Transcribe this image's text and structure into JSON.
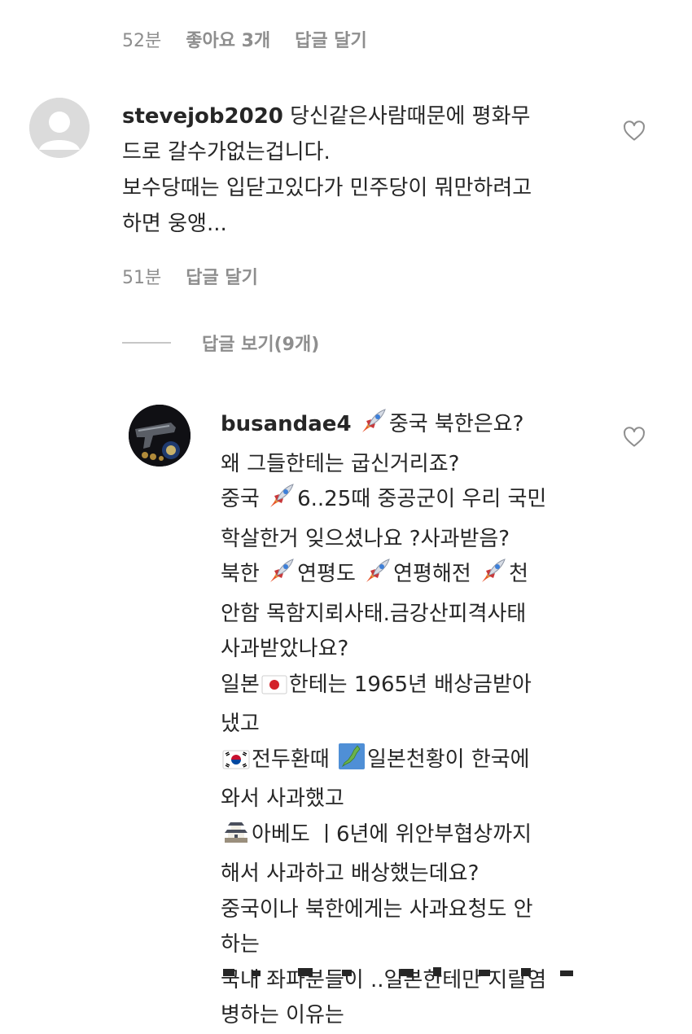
{
  "top_meta": {
    "time": "52분",
    "likes": "좋아요 3개",
    "reply": "답글 달기"
  },
  "comment1": {
    "username": "stevejob2020",
    "line1_rest": " 당신같은사람때문에 평화무",
    "line2": "드로 갈수가없는겁니다.",
    "line3": "보수당때는 입닫고있다가 민주당이 뭐만하려고",
    "line4": "하면 웅앵...",
    "time": "51분",
    "reply": "답글 달기",
    "like_icon": "heart-outline-icon"
  },
  "replies_toggle": {
    "label": "답글 보기(9개)"
  },
  "comment2": {
    "username": "busandae4",
    "l1": "중국 북한은요?",
    "l2": "왜 그들한테는 굽신거리죠?",
    "l3a": "중국 ",
    "l3b": "6..25때 중공군이 우리 국민",
    "l4": "학살한거 잊으셨나요 ?사과받음?",
    "l5a": "북한 ",
    "l5b": "연평도 ",
    "l5c": "연평해전 ",
    "l5d": "천",
    "l6": "안함 목함지뢰사태.금강산피격사태",
    "l7": "사과받았나요?",
    "l8a": "일본",
    "l8b": "한테는 1965년 배상금받아",
    "l9": "냈고",
    "l10a": "전두환때 ",
    "l10b": "일본천황이 한국에",
    "l11": "와서 사과했고",
    "l12a": "아베도 ㅣ6년에 위안부협상까지",
    "l13": "해서 사과하고 배상했는데요?",
    "l14": "중국이나 북한에게는 사과요청도 안",
    "l15": "하는",
    "l16": "국내 좌파분들이 ..일본한테만 지랄염",
    "l17": "병하는 이유는",
    "like_icon": "heart-outline-icon",
    "emoji_icons": [
      "rocket-icon",
      "japan-flag-icon",
      "korea-flag-icon",
      "japan-map-icon",
      "japanese-castle-icon"
    ]
  }
}
